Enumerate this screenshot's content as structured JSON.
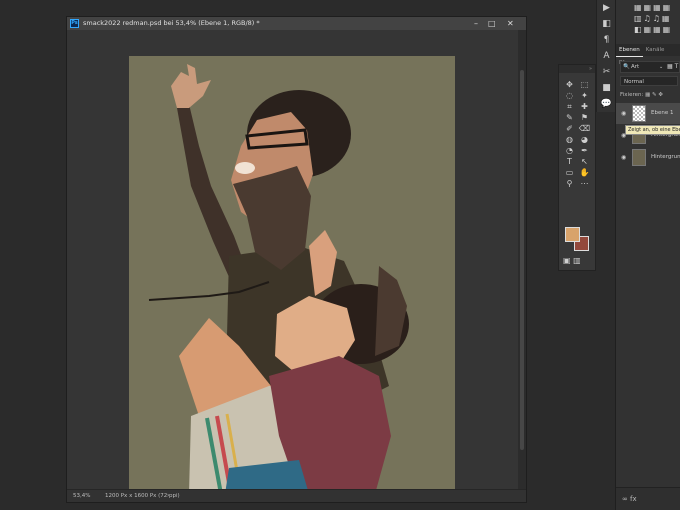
{
  "document": {
    "title": "smack2022 redman.psd bei 53,4% (Ebene 1, RGB/8) *",
    "app_badge": "Ps",
    "minimize": "–",
    "maximize": "□",
    "close": "✕",
    "status_zoom": "53,4%",
    "status_dims": "1200 Px x 1600 Px (72 ppi)",
    "status_arrow": "›"
  },
  "tools": {
    "header": "»",
    "items": [
      "✥",
      "⬚",
      "◌",
      "✦",
      "⌗",
      "✚",
      "✎",
      "⚑",
      "✐",
      "⌫",
      "◍",
      "◕",
      "◔",
      "✒",
      "T",
      "↖",
      "▭",
      "✋",
      "⚲",
      "⋯"
    ],
    "bottom": "▣ ▥"
  },
  "strip": {
    "items": [
      "▶",
      "◧",
      "¶",
      "A",
      "✂",
      "■",
      "💬"
    ]
  },
  "panels": {
    "swatch_row1": "▦▦▦▦",
    "swatch_row2": "▥♫♫▦",
    "swatch_row3": "◧▦▦▦",
    "tabs": [
      "Ebenen",
      "Kanäle",
      "Pfa"
    ],
    "filter_icon": "🔍",
    "filter_label": "Art",
    "filter_dd": "⌄",
    "filter_icons": "▦ T",
    "blend_mode": "Normal",
    "lock_label": "Fixieren:",
    "lock_icons": "▦ ✎ ✥",
    "layers": [
      {
        "name": "Ebene 1",
        "selected": true
      },
      {
        "name": "Hintergrund",
        "selected": false
      },
      {
        "name": "Hintergrund",
        "selected": false
      }
    ],
    "tooltip": "Zeigt an, ob eine Ebene",
    "footer": "∞ fx"
  },
  "colors": {
    "foreground": "#d8a36b",
    "background": "#93493c",
    "canvas_bg": "#76735a"
  }
}
